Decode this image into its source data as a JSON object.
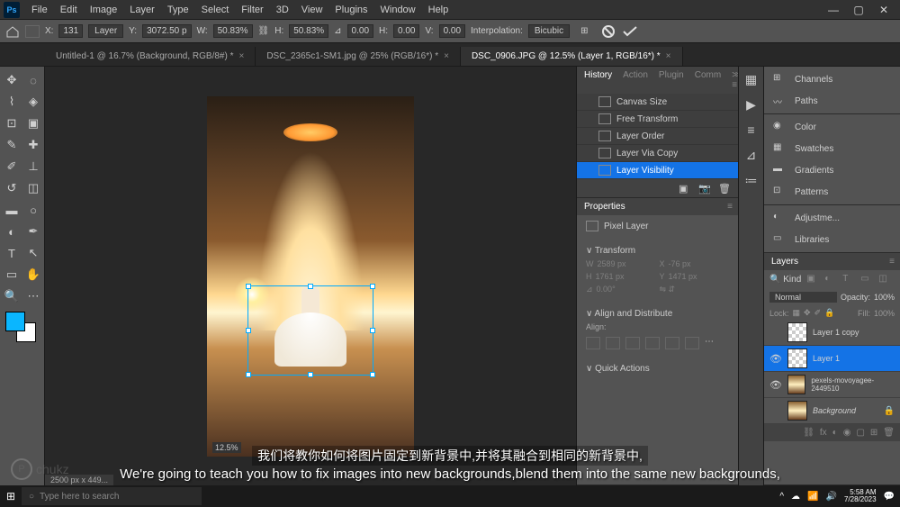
{
  "menubar": {
    "items": [
      "File",
      "Edit",
      "Image",
      "Layer",
      "Type",
      "Select",
      "Filter",
      "3D",
      "View",
      "Plugins",
      "Window",
      "Help"
    ]
  },
  "optionsbar": {
    "x_label": "X:",
    "x_value": "131",
    "layer_dd": "Layer",
    "y_label": "Y:",
    "y_value": "3072.50 p",
    "w_label": "W:",
    "w_value": "50.83%",
    "h_label": "H:",
    "h_value": "50.83%",
    "angle_label": "⊿",
    "angle_value": "0.00",
    "skew_h": "H:",
    "skew_h_value": "0.00",
    "skew_v": "V:",
    "skew_v_value": "0.00",
    "interp_label": "Interpolation:",
    "interp_value": "Bicubic"
  },
  "tabs": [
    {
      "label": "Untitled-1 @ 16.7% (Background, RGB/8#) *",
      "active": false
    },
    {
      "label": "DSC_2365c1-SM1.jpg @ 25% (RGB/16*) *",
      "active": false
    },
    {
      "label": "DSC_0906.JPG @ 12.5% (Layer 1, RGB/16*) *",
      "active": true
    }
  ],
  "history": {
    "tabs": [
      "History",
      "Action",
      "Plugin",
      "Comm"
    ],
    "items": [
      "Canvas Size",
      "Free Transform",
      "Layer Order",
      "Layer Via Copy",
      "Layer Visibility"
    ],
    "selected": 4
  },
  "properties": {
    "title": "Properties",
    "kind": "Pixel Layer",
    "sections": {
      "transform": "Transform",
      "align": "Align and Distribute",
      "align_sub": "Align:",
      "quick": "Quick Actions"
    },
    "transform_vals": {
      "w": "2589 px",
      "x": "-76 px",
      "h": "1761 px",
      "y": "1471 px",
      "angle": "0.00°"
    }
  },
  "rightstrip": {
    "items": [
      {
        "icon": "⊞",
        "label": "Channels"
      },
      {
        "icon": "〰",
        "label": "Paths"
      }
    ],
    "items2": [
      {
        "icon": "▦",
        "label": "Swatches"
      },
      {
        "icon": "▬",
        "label": "Gradients"
      },
      {
        "icon": "⊡",
        "label": "Patterns"
      }
    ],
    "items3": [
      {
        "icon": "◐",
        "label": "Adjustme..."
      },
      {
        "icon": "▭",
        "label": "Libraries"
      }
    ],
    "color_label": "Color"
  },
  "layers": {
    "title": "Layers",
    "kind_label": "Kind",
    "blend": "Normal",
    "opacity_label": "Opacity:",
    "opacity_value": "100%",
    "lock_label": "Lock:",
    "fill_label": "Fill:",
    "fill_value": "100%",
    "rows": [
      {
        "name": "Layer 1 copy",
        "visible": false,
        "sel": false,
        "thumb": "checker"
      },
      {
        "name": "Layer 1",
        "visible": true,
        "sel": true,
        "thumb": "checker"
      },
      {
        "name": "pexels-movoyagee-2449510",
        "visible": true,
        "sel": false,
        "thumb": "img"
      },
      {
        "name": "Background",
        "visible": false,
        "sel": false,
        "thumb": "img",
        "locked": true,
        "italic": true
      }
    ]
  },
  "canvas": {
    "zoom": "12.5%"
  },
  "statusbar": "2500 px x 449...",
  "subtitle": {
    "cn": "我们将教你如何将图片固定到新背景中,并将其融合到相同的新背景中,",
    "en": "We're going to teach you how to fix images into new backgrounds,blend them into the same new backgrounds,"
  },
  "taskbar": {
    "search_placeholder": "Type here to search",
    "time": "5:58 AM",
    "date": "7/28/2023"
  },
  "watermark": "chukz"
}
